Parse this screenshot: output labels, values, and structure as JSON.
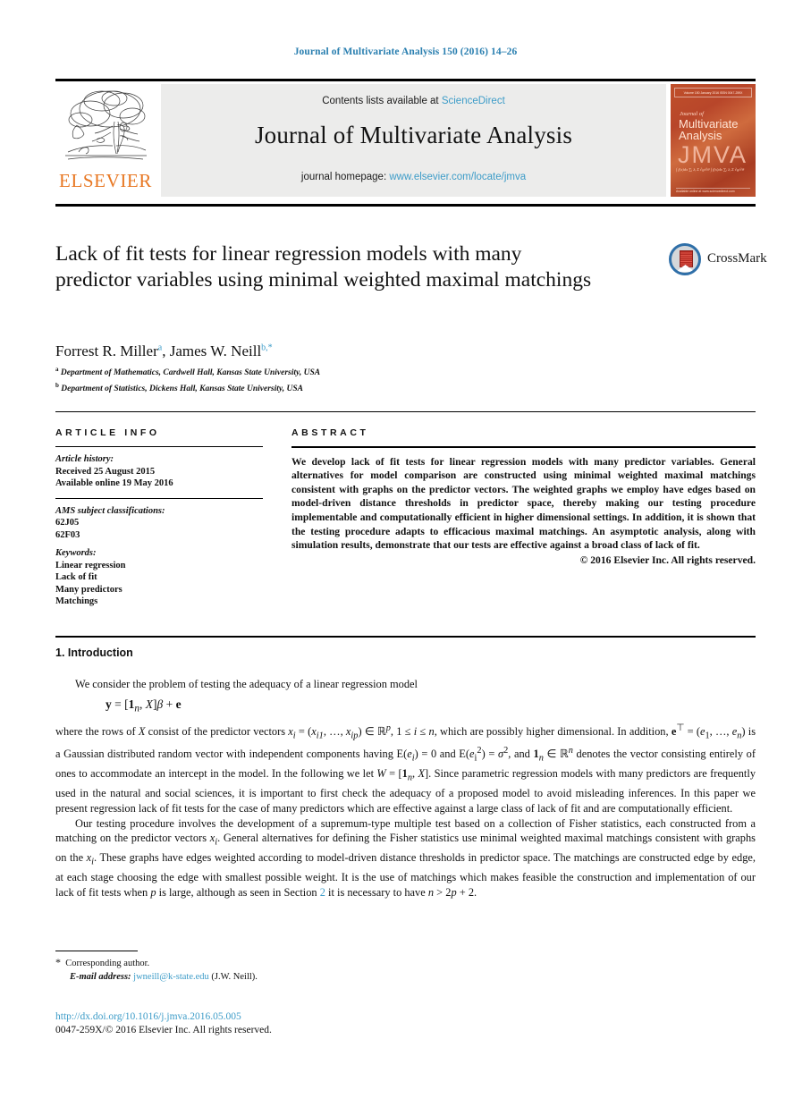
{
  "running_head": "Journal of Multivariate Analysis 150 (2016) 14–26",
  "masthead": {
    "contents_prefix": "Contents lists available at ",
    "sciencedirect": "ScienceDirect",
    "journal_name": "Journal of Multivariate Analysis",
    "homepage_prefix": "journal homepage: ",
    "homepage_url": "www.elsevier.com/locate/jmva",
    "publisher": "ELSEVIER",
    "cover": {
      "elsevier_mark": "ELSEVIER",
      "top_bar": "Volume 150   January 2016   ISSN 0047-259X",
      "small_line": "Journal of",
      "title_line1": "Multivariate",
      "title_line2": "Analysis",
      "acronym": "JMVA",
      "formula_line": "∫ f(x)dx ∑ᵢ λᵢ Σ ∂g/∂θ ∫ f(x)dx ∑ᵢ λᵢ Σ ∂g/∂θ",
      "footer": "Available online at www.sciencedirect.com"
    }
  },
  "article": {
    "title": "Lack of fit tests for linear regression models with many predictor variables using minimal weighted maximal matchings",
    "crossmark_label": "CrossMark",
    "authors": [
      {
        "name": "Forrest R. Miller",
        "sup": "a",
        "star": false
      },
      {
        "name": "James W. Neill",
        "sup": "b",
        "star": true
      }
    ],
    "authors_separator": ", ",
    "affiliations": [
      {
        "marker": "a",
        "text": "Department of Mathematics, Cardwell Hall, Kansas State University, USA"
      },
      {
        "marker": "b",
        "text": "Department of Statistics, Dickens Hall, Kansas State University, USA"
      }
    ]
  },
  "article_info": {
    "heading": "ARTICLE INFO",
    "history_label": "Article history:",
    "history": [
      "Received 25 August 2015",
      "Available online 19 May 2016"
    ],
    "ams_label": "AMS subject classifications:",
    "ams": [
      "62J05",
      "62F03"
    ],
    "keywords_label": "Keywords:",
    "keywords": [
      "Linear regression",
      "Lack of fit",
      "Many predictors",
      "Matchings"
    ]
  },
  "abstract": {
    "heading": "ABSTRACT",
    "text": "We develop lack of fit tests for linear regression models with many predictor variables. General alternatives for model comparison are constructed using minimal weighted maximal matchings consistent with graphs on the predictor vectors. The weighted graphs we employ have edges based on model-driven distance thresholds in predictor space, thereby making our testing procedure implementable and computationally efficient in higher dimensional settings. In addition, it is shown that the testing procedure adapts to efficacious maximal matchings. An asymptotic analysis, along with simulation results, demonstrate that our tests are effective against a broad class of lack of fit.",
    "copyright": "© 2016 Elsevier Inc. All rights reserved."
  },
  "section": {
    "number": "1.",
    "title": "Introduction",
    "para1_lead": "We consider the problem of testing the adequacy of a linear regression model",
    "equation": "y = [1n, X]β + e",
    "para1_rest": "where the rows of X consist of the predictor vectors xi = (xi1, …, xip) ∈ ℝp, 1 ≤ i ≤ n, which are possibly higher dimensional. In addition, e⊤ = (e1, …, en) is a Gaussian distributed random vector with independent components having E(ei) = 0 and E(ei2) = σ2, and 1n ∈ ℝn denotes the vector consisting entirely of ones to accommodate an intercept in the model. In the following we let W = [1n, X]. Since parametric regression models with many predictors are frequently used in the natural and social sciences, it is important to first check the adequacy of a proposed model to avoid misleading inferences. In this paper we present regression lack of fit tests for the case of many predictors which are effective against a large class of lack of fit and are computationally efficient.",
    "para2": "Our testing procedure involves the development of a supremum-type multiple test based on a collection of Fisher statistics, each constructed from a matching on the predictor vectors xi. General alternatives for defining the Fisher statistics use minimal weighted maximal matchings consistent with graphs on the xi. These graphs have edges weighted according to model-driven distance thresholds in predictor space. The matchings are constructed edge by edge, at each stage choosing the edge with smallest possible weight. It is the use of matchings which makes feasible the construction and implementation of our lack of fit tests when p is large, although as seen in Section 2 it is necessary to have n > 2p + 2.",
    "section_ref": "2"
  },
  "footnote": {
    "star": "*",
    "corresponding": "Corresponding author.",
    "email_label": "E-mail address:",
    "email": "jwneill@k-state.edu",
    "email_owner": "(J.W. Neill)."
  },
  "footer": {
    "doi": "http://dx.doi.org/10.1016/j.jmva.2016.05.005",
    "issn_line": "0047-259X/© 2016 Elsevier Inc. All rights reserved."
  },
  "colors": {
    "link_blue": "#3d9cc8",
    "head_blue": "#2a7fb0",
    "elsevier_orange": "#E87722",
    "cover_rust": "#b8462a"
  }
}
